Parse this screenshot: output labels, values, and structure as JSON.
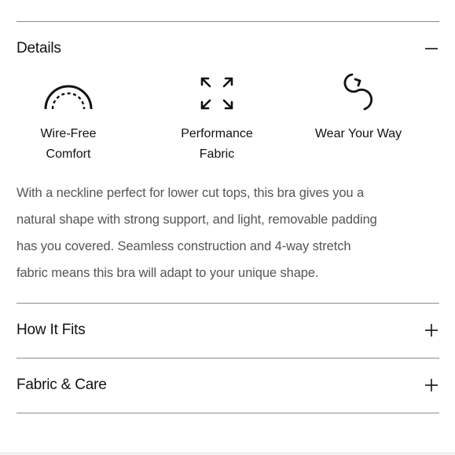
{
  "details": {
    "title": "Details",
    "toggle_icon": "minus-icon",
    "features": [
      {
        "icon": "arc-icon",
        "label_line1": "Wire-Free",
        "label_line2": "Comfort"
      },
      {
        "icon": "expand-arrows-icon",
        "label_line1": "Performance",
        "label_line2": "Fabric"
      },
      {
        "icon": "infinity-loop-icon",
        "label_line1": "Wear Your Way",
        "label_line2": ""
      }
    ],
    "description_lines": [
      "With a neckline perfect for lower cut tops, this bra gives you a",
      "natural shape with strong support, and light, removable padding",
      "has you covered. Seamless construction and 4-way stretch",
      "fabric means this bra will adapt to your unique shape."
    ]
  },
  "how_it_fits": {
    "title": "How It Fits",
    "toggle_icon": "plus-icon"
  },
  "fabric_care": {
    "title": "Fabric & Care",
    "toggle_icon": "plus-icon"
  }
}
